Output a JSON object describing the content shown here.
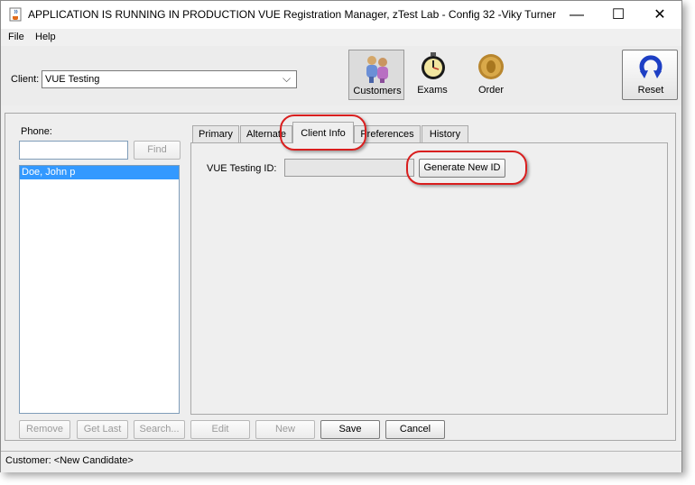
{
  "window": {
    "title": "APPLICATION IS RUNNING IN PRODUCTION  VUE Registration Manager, zTest Lab - Config 32 -Viky Turner",
    "minimize": "—",
    "maximize": "☐",
    "close": "✕"
  },
  "menu": {
    "file": "File",
    "help": "Help"
  },
  "client": {
    "label": "Client:",
    "value": "VUE Testing",
    "arrow": "⌵"
  },
  "toolbar": {
    "customers": "Customers",
    "exams": "Exams",
    "order": "Order",
    "reset": "Reset"
  },
  "search": {
    "phone_label": "Phone:",
    "phone_value": "",
    "find": "Find",
    "results": [
      "Doe, John p"
    ]
  },
  "tabs": [
    "Primary",
    "Alternate",
    "Client Info",
    "Preferences",
    "History"
  ],
  "client_info": {
    "id_label": "VUE Testing ID:",
    "id_value": "",
    "generate": "Generate New ID"
  },
  "buttons": {
    "remove": "Remove",
    "get_last": "Get Last",
    "search": "Search...",
    "edit": "Edit",
    "new": "New",
    "save": "Save",
    "cancel": "Cancel"
  },
  "status": {
    "text": "Customer: <New Candidate>"
  },
  "colors": {
    "selection": "#3399ff",
    "annotation": "#d91e1e"
  }
}
